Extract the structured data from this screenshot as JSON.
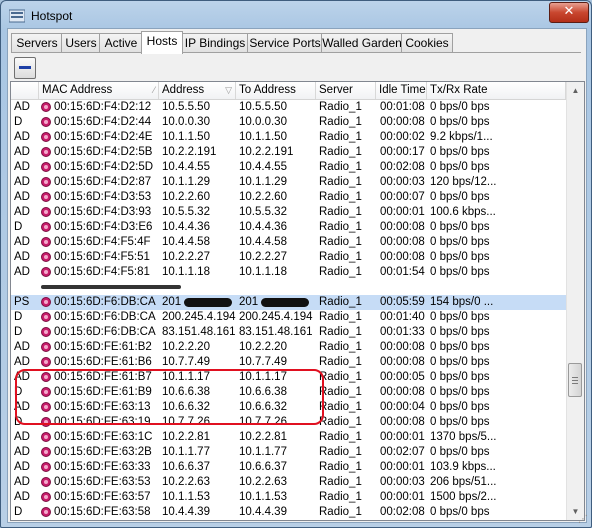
{
  "window": {
    "title": "Hotspot",
    "close_label": "✕"
  },
  "tabs": [
    "Servers",
    "Users",
    "Active",
    "Hosts",
    "IP Bindings",
    "Service Ports",
    "Walled Garden",
    "Cookies"
  ],
  "active_tab": "Hosts",
  "toolbar": {
    "remove_icon": "minus-icon"
  },
  "columns": [
    "",
    "MAC Address",
    "Address",
    "To Address",
    "Server",
    "Idle Time",
    "Tx/Rx Rate"
  ],
  "rows": [
    {
      "flags": "AD",
      "mac": "00:15:6D:F4:D2:12",
      "address": "10.5.5.50",
      "to_address": "10.5.5.50",
      "server": "Radio_1",
      "idle": "00:01:08",
      "rate": "0 bps/0 bps"
    },
    {
      "flags": "D",
      "mac": "00:15:6D:F4:D2:44",
      "address": "10.0.0.30",
      "to_address": "10.0.0.30",
      "server": "Radio_1",
      "idle": "00:00:08",
      "rate": "0 bps/0 bps"
    },
    {
      "flags": "AD",
      "mac": "00:15:6D:F4:D2:4E",
      "address": "10.1.1.50",
      "to_address": "10.1.1.50",
      "server": "Radio_1",
      "idle": "00:00:02",
      "rate": "9.2 kbps/1..."
    },
    {
      "flags": "AD",
      "mac": "00:15:6D:F4:D2:5B",
      "address": "10.2.2.191",
      "to_address": "10.2.2.191",
      "server": "Radio_1",
      "idle": "00:00:17",
      "rate": "0 bps/0 bps"
    },
    {
      "flags": "AD",
      "mac": "00:15:6D:F4:D2:5D",
      "address": "10.4.4.55",
      "to_address": "10.4.4.55",
      "server": "Radio_1",
      "idle": "00:02:08",
      "rate": "0 bps/0 bps"
    },
    {
      "flags": "AD",
      "mac": "00:15:6D:F4:D2:87",
      "address": "10.1.1.29",
      "to_address": "10.1.1.29",
      "server": "Radio_1",
      "idle": "00:00:03",
      "rate": "120 bps/12..."
    },
    {
      "flags": "AD",
      "mac": "00:15:6D:F4:D3:53",
      "address": "10.2.2.60",
      "to_address": "10.2.2.60",
      "server": "Radio_1",
      "idle": "00:00:07",
      "rate": "0 bps/0 bps"
    },
    {
      "flags": "AD",
      "mac": "00:15:6D:F4:D3:93",
      "address": "10.5.5.32",
      "to_address": "10.5.5.32",
      "server": "Radio_1",
      "idle": "00:00:01",
      "rate": "100.6 kbps..."
    },
    {
      "flags": "D",
      "mac": "00:15:6D:F4:D3:E6",
      "address": "10.4.4.36",
      "to_address": "10.4.4.36",
      "server": "Radio_1",
      "idle": "00:00:08",
      "rate": "0 bps/0 bps"
    },
    {
      "flags": "AD",
      "mac": "00:15:6D:F4:F5:4F",
      "address": "10.4.4.58",
      "to_address": "10.4.4.58",
      "server": "Radio_1",
      "idle": "00:00:08",
      "rate": "0 bps/0 bps"
    },
    {
      "flags": "AD",
      "mac": "00:15:6D:F4:F5:51",
      "address": "10.2.2.27",
      "to_address": "10.2.2.27",
      "server": "Radio_1",
      "idle": "00:00:08",
      "rate": "0 bps/0 bps"
    },
    {
      "flags": "AD",
      "mac": "00:15:6D:F4:F5:81",
      "address": "10.1.1.18",
      "to_address": "10.1.1.18",
      "server": "Radio_1",
      "idle": "00:01:54",
      "rate": "0 bps/0 bps"
    },
    {
      "flags": "",
      "mac": "",
      "address": "",
      "to_address": "",
      "server": "",
      "idle": "",
      "rate": "",
      "redacted": true
    },
    {
      "flags": "PS",
      "mac": "00:15:6D:F6:DB:CA",
      "address": "201",
      "to_address": "201",
      "server": "Radio_1",
      "idle": "00:05:59",
      "rate": "154 bps/0 ...",
      "selected": true,
      "redact_addr": true
    },
    {
      "flags": "D",
      "mac": "00:15:6D:F6:DB:CA",
      "address": "200.245.4.194",
      "to_address": "200.245.4.194",
      "server": "Radio_1",
      "idle": "00:01:40",
      "rate": "0 bps/0 bps"
    },
    {
      "flags": "D",
      "mac": "00:15:6D:F6:DB:CA",
      "address": "83.151.48.161",
      "to_address": "83.151.48.161",
      "server": "Radio_1",
      "idle": "00:01:33",
      "rate": "0 bps/0 bps"
    },
    {
      "flags": "AD",
      "mac": "00:15:6D:FE:61:B2",
      "address": "10.2.2.20",
      "to_address": "10.2.2.20",
      "server": "Radio_1",
      "idle": "00:00:08",
      "rate": "0 bps/0 bps"
    },
    {
      "flags": "AD",
      "mac": "00:15:6D:FE:61:B6",
      "address": "10.7.7.49",
      "to_address": "10.7.7.49",
      "server": "Radio_1",
      "idle": "00:00:08",
      "rate": "0 bps/0 bps"
    },
    {
      "flags": "AD",
      "mac": "00:15:6D:FE:61:B7",
      "address": "10.1.1.17",
      "to_address": "10.1.1.17",
      "server": "Radio_1",
      "idle": "00:00:05",
      "rate": "0 bps/0 bps"
    },
    {
      "flags": "D",
      "mac": "00:15:6D:FE:61:B9",
      "address": "10.6.6.38",
      "to_address": "10.6.6.38",
      "server": "Radio_1",
      "idle": "00:00:08",
      "rate": "0 bps/0 bps"
    },
    {
      "flags": "AD",
      "mac": "00:15:6D:FE:63:13",
      "address": "10.6.6.32",
      "to_address": "10.6.6.32",
      "server": "Radio_1",
      "idle": "00:00:04",
      "rate": "0 bps/0 bps"
    },
    {
      "flags": "D",
      "mac": "00:15:6D:FE:63:19",
      "address": "10.7.7.26",
      "to_address": "10.7.7.26",
      "server": "Radio_1",
      "idle": "00:00:08",
      "rate": "0 bps/0 bps"
    },
    {
      "flags": "AD",
      "mac": "00:15:6D:FE:63:1C",
      "address": "10.2.2.81",
      "to_address": "10.2.2.81",
      "server": "Radio_1",
      "idle": "00:00:01",
      "rate": "1370 bps/5..."
    },
    {
      "flags": "AD",
      "mac": "00:15:6D:FE:63:2B",
      "address": "10.1.1.77",
      "to_address": "10.1.1.77",
      "server": "Radio_1",
      "idle": "00:02:07",
      "rate": "0 bps/0 bps"
    },
    {
      "flags": "AD",
      "mac": "00:15:6D:FE:63:33",
      "address": "10.6.6.37",
      "to_address": "10.6.6.37",
      "server": "Radio_1",
      "idle": "00:00:01",
      "rate": "103.9 kbps..."
    },
    {
      "flags": "AD",
      "mac": "00:15:6D:FE:63:53",
      "address": "10.2.2.63",
      "to_address": "10.2.2.63",
      "server": "Radio_1",
      "idle": "00:00:03",
      "rate": "206 bps/51..."
    },
    {
      "flags": "AD",
      "mac": "00:15:6D:FE:63:57",
      "address": "10.1.1.53",
      "to_address": "10.1.1.53",
      "server": "Radio_1",
      "idle": "00:00:01",
      "rate": "1500 bps/2..."
    },
    {
      "flags": "D",
      "mac": "00:15:6D:FE:63:58",
      "address": "10.4.4.39",
      "to_address": "10.4.4.39",
      "server": "Radio_1",
      "idle": "00:02:08",
      "rate": "0 bps/0 bps"
    }
  ]
}
